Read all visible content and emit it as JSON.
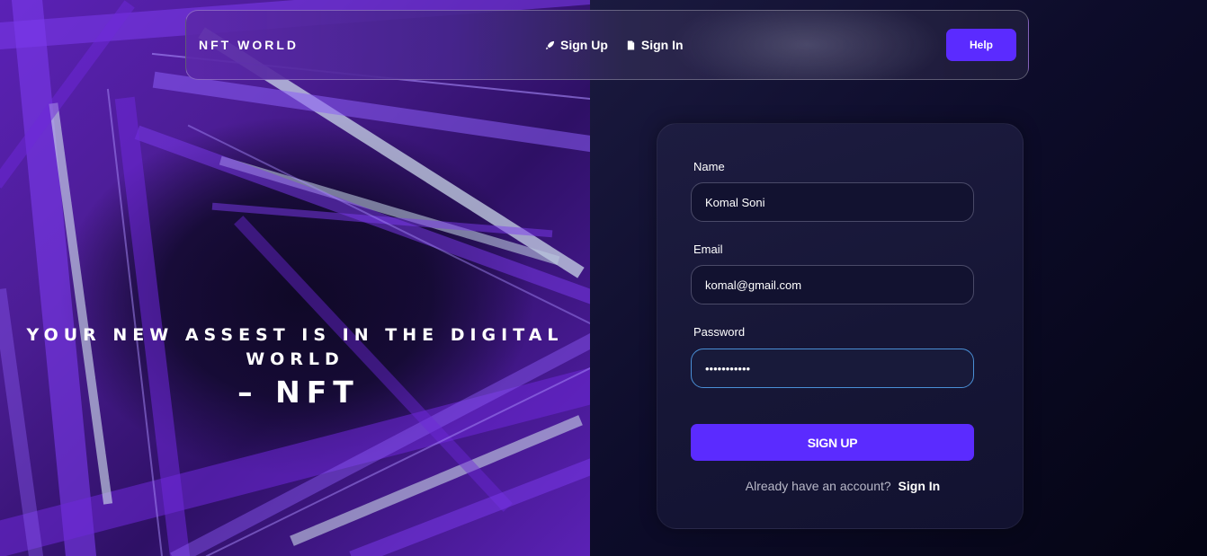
{
  "navbar": {
    "brand": "NFT WORLD",
    "links": [
      {
        "label": "Sign Up",
        "icon": "rocket-icon"
      },
      {
        "label": "Sign In",
        "icon": "document-icon"
      }
    ],
    "help_label": "Help"
  },
  "hero": {
    "headline_line1": "YOUR NEW ASSEST IS IN THE DIGITAL",
    "headline_line2": "WORLD",
    "tagline": "– NFT"
  },
  "form": {
    "name": {
      "label": "Name",
      "value": "Komal Soni"
    },
    "email": {
      "label": "Email",
      "value": "komal@gmail.com"
    },
    "password": {
      "label": "Password",
      "value": "•••••••••••"
    },
    "submit_label": "SIGN UP",
    "switch_prompt": "Already have an account?",
    "switch_link": "Sign In"
  },
  "colors": {
    "accent": "#5b2bff",
    "focus_border": "#4a8fd6",
    "card_bg": "#161636",
    "page_bg": "#0b0a24"
  }
}
